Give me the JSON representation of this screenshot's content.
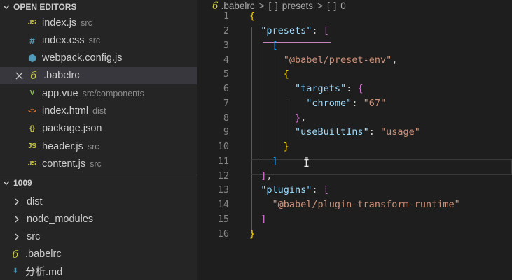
{
  "explorer": {
    "open_editors_title": "OPEN EDITORS",
    "open_editors": [
      {
        "icon": "js-icon",
        "glyph": "JS",
        "color": "#cbcb41",
        "name": "index.js",
        "desc": "src"
      },
      {
        "icon": "css-icon",
        "glyph": "#",
        "color": "#519aba",
        "name": "index.css",
        "desc": "src"
      },
      {
        "icon": "webpack-icon",
        "glyph": "⬢",
        "color": "#519aba",
        "name": "webpack.config.js",
        "desc": ""
      },
      {
        "icon": "babel-icon",
        "glyph": "6",
        "color": "#cbcb41",
        "name": ".babelrc",
        "desc": "",
        "active": true
      },
      {
        "icon": "vue-icon",
        "glyph": "V",
        "color": "#8dc149",
        "name": "app.vue",
        "desc": "src/components"
      },
      {
        "icon": "html-icon",
        "glyph": "<>",
        "color": "#e37933",
        "name": "index.html",
        "desc": "dist"
      },
      {
        "icon": "json-icon",
        "glyph": "{}",
        "color": "#cbcb41",
        "name": "package.json",
        "desc": ""
      },
      {
        "icon": "js-icon",
        "glyph": "JS",
        "color": "#cbcb41",
        "name": "header.js",
        "desc": "src"
      },
      {
        "icon": "js-icon",
        "glyph": "JS",
        "color": "#cbcb41",
        "name": "content.js",
        "desc": "src"
      }
    ],
    "project_title": "1009",
    "folders": [
      {
        "name": "dist"
      },
      {
        "name": "node_modules"
      },
      {
        "name": "src"
      }
    ],
    "root_files": [
      {
        "icon": "babel-icon",
        "glyph": "6",
        "color": "#cbcb41",
        "name": ".babelrc"
      },
      {
        "icon": "markdown-icon",
        "glyph": "⬇",
        "color": "#519aba",
        "name": "分析.md"
      }
    ]
  },
  "breadcrumb": {
    "file": ".babelrc",
    "items": [
      "presets",
      "0"
    ],
    "item_icon": "[ ]"
  },
  "code_lines": [
    {
      "n": "1",
      "tokens": [
        {
          "c": "b1",
          "t": "{"
        }
      ]
    },
    {
      "n": "2",
      "tokens": [
        {
          "c": "p",
          "t": "  "
        },
        {
          "c": "k",
          "t": "\"presets\""
        },
        {
          "c": "p",
          "t": ": "
        },
        {
          "c": "b2",
          "t": "["
        }
      ]
    },
    {
      "n": "3",
      "tokens": [
        {
          "c": "p",
          "t": "    "
        },
        {
          "c": "b3",
          "t": "["
        }
      ]
    },
    {
      "n": "4",
      "tokens": [
        {
          "c": "p",
          "t": "      "
        },
        {
          "c": "s",
          "t": "\"@babel/preset-env\""
        },
        {
          "c": "p",
          "t": ","
        }
      ]
    },
    {
      "n": "5",
      "tokens": [
        {
          "c": "p",
          "t": "      "
        },
        {
          "c": "b1",
          "t": "{"
        }
      ]
    },
    {
      "n": "6",
      "tokens": [
        {
          "c": "p",
          "t": "        "
        },
        {
          "c": "k",
          "t": "\"targets\""
        },
        {
          "c": "p",
          "t": ": "
        },
        {
          "c": "b2",
          "t": "{"
        }
      ]
    },
    {
      "n": "7",
      "tokens": [
        {
          "c": "p",
          "t": "          "
        },
        {
          "c": "k",
          "t": "\"chrome\""
        },
        {
          "c": "p",
          "t": ": "
        },
        {
          "c": "s",
          "t": "\"67\""
        }
      ]
    },
    {
      "n": "8",
      "tokens": [
        {
          "c": "p",
          "t": "        "
        },
        {
          "c": "b2",
          "t": "}"
        },
        {
          "c": "p",
          "t": ","
        }
      ]
    },
    {
      "n": "9",
      "tokens": [
        {
          "c": "p",
          "t": "        "
        },
        {
          "c": "k",
          "t": "\"useBuiltIns\""
        },
        {
          "c": "p",
          "t": ": "
        },
        {
          "c": "s",
          "t": "\"usage\""
        }
      ]
    },
    {
      "n": "10",
      "tokens": [
        {
          "c": "p",
          "t": "      "
        },
        {
          "c": "b1",
          "t": "}"
        }
      ]
    },
    {
      "n": "11",
      "tokens": [
        {
          "c": "p",
          "t": "    "
        },
        {
          "c": "b3",
          "t": "]"
        }
      ]
    },
    {
      "n": "12",
      "tokens": [
        {
          "c": "p",
          "t": "  "
        },
        {
          "c": "b2",
          "t": "]"
        },
        {
          "c": "p",
          "t": ","
        }
      ]
    },
    {
      "n": "13",
      "tokens": [
        {
          "c": "p",
          "t": "  "
        },
        {
          "c": "k",
          "t": "\"plugins\""
        },
        {
          "c": "p",
          "t": ": "
        },
        {
          "c": "b2",
          "t": "["
        }
      ]
    },
    {
      "n": "14",
      "tokens": [
        {
          "c": "p",
          "t": "    "
        },
        {
          "c": "s",
          "t": "\"@babel/plugin-transform-runtime\""
        }
      ]
    },
    {
      "n": "15",
      "tokens": [
        {
          "c": "p",
          "t": "  "
        },
        {
          "c": "b2",
          "t": "]"
        }
      ]
    },
    {
      "n": "16",
      "tokens": [
        {
          "c": "b1",
          "t": "}"
        }
      ]
    }
  ]
}
